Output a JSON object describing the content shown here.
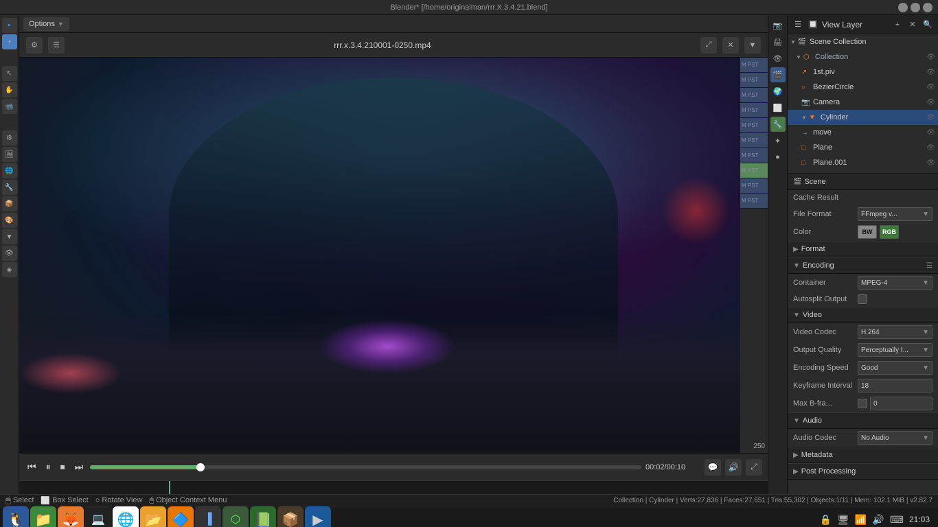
{
  "window": {
    "title": "Blender* [/home/originalman/rrr.X.3.4.21.blend]",
    "controls": [
      "minimize",
      "maximize",
      "close"
    ]
  },
  "video_player": {
    "title": "rrr.x.3.4.210001-0250.mp4",
    "time_current": "00:02",
    "time_total": "00:10",
    "progress_percent": 20,
    "controls": {
      "rewind": "⏮",
      "play_pause": "⏸",
      "stop": "⏹",
      "fast_forward": "⏭"
    },
    "options_label": "Options",
    "close_label": "✕"
  },
  "outliner": {
    "panel_title": "View Layer",
    "scene_collection_label": "Scene Collection",
    "collection_label": "Collection",
    "items": [
      {
        "name": "1st.piv",
        "icon": "📍",
        "type": "pivot"
      },
      {
        "name": "BezierCircle",
        "icon": "○",
        "type": "curve"
      },
      {
        "name": "Camera",
        "icon": "📷",
        "type": "camera"
      },
      {
        "name": "Cylinder",
        "icon": "▼",
        "type": "mesh",
        "selected": true
      },
      {
        "name": "move",
        "icon": "→",
        "type": "empty"
      },
      {
        "name": "Plane",
        "icon": "□",
        "type": "mesh"
      },
      {
        "name": "Plane.001",
        "icon": "□",
        "type": "mesh"
      }
    ]
  },
  "properties": {
    "section_scene": "Scene",
    "cache_result_label": "Cache Result",
    "file_format_label": "File Format",
    "file_format_value": "FFmpeg v...",
    "color_label": "Color",
    "color_bw": "BW",
    "color_rgb": "RGB",
    "section_format": "Format",
    "section_encoding": "Encoding",
    "container_label": "Container",
    "container_value": "MPEG-4",
    "autosplit_label": "Autosplit Output",
    "section_video": "Video",
    "video_codec_label": "Video Codec",
    "video_codec_value": "H.264",
    "section_output_quality": "Output Quality",
    "output_quality_label": "Output Quality",
    "output_quality_value": "Perceptually I...",
    "encoding_speed_label": "Encoding Speed",
    "encoding_speed_value": "Good",
    "keyframe_interval_label": "Keyframe Interval",
    "keyframe_interval_value": "18",
    "max_bframes_label": "Max B-fra...",
    "max_bframes_value": "0",
    "section_audio": "Audio",
    "audio_codec_label": "Audio Codec",
    "audio_codec_value": "No Audio",
    "section_metadata": "Metadata",
    "section_post_processing": "Post Processing"
  },
  "status_bar": {
    "select_label": "Select",
    "box_select_label": "Box Select",
    "rotate_view_label": "Rotate View",
    "context_menu_label": "Object Context Menu",
    "stats": "Collection | Cylinder | Verts:27,836 | Faces:27,651 | Tris:55,302 | Objects:1/11 | Mem: 102.1 MiB | v2.82.7"
  },
  "taskbar": {
    "apps": [
      {
        "name": "system-settings",
        "color": "#4a90d9",
        "label": "🐧"
      },
      {
        "name": "files",
        "color": "#5cb85c",
        "label": "📁"
      },
      {
        "name": "firefox",
        "color": "#e87a30",
        "label": "🦊"
      },
      {
        "name": "terminal",
        "color": "#333",
        "label": "💻"
      },
      {
        "name": "chrome",
        "color": "#4285f4",
        "label": "🌐"
      },
      {
        "name": "folder",
        "color": "#e8a030",
        "label": "📂"
      },
      {
        "name": "blender",
        "color": "#ea7600",
        "label": "🔷"
      },
      {
        "name": "app7",
        "color": "#333",
        "label": "▐"
      },
      {
        "name": "app8",
        "color": "#333",
        "label": "⬡"
      },
      {
        "name": "app9",
        "color": "#3a9a3a",
        "label": "📗"
      },
      {
        "name": "app10",
        "color": "#333",
        "label": "📦"
      },
      {
        "name": "media-player",
        "color": "#2a6a9a",
        "label": "▶"
      }
    ],
    "time": "21:03"
  },
  "timeline_strips": [
    "M PST",
    "M PST",
    "M PST",
    "M PST",
    "M PST",
    "M PST",
    "M PST",
    "M PST",
    "M PST",
    "M PST"
  ]
}
